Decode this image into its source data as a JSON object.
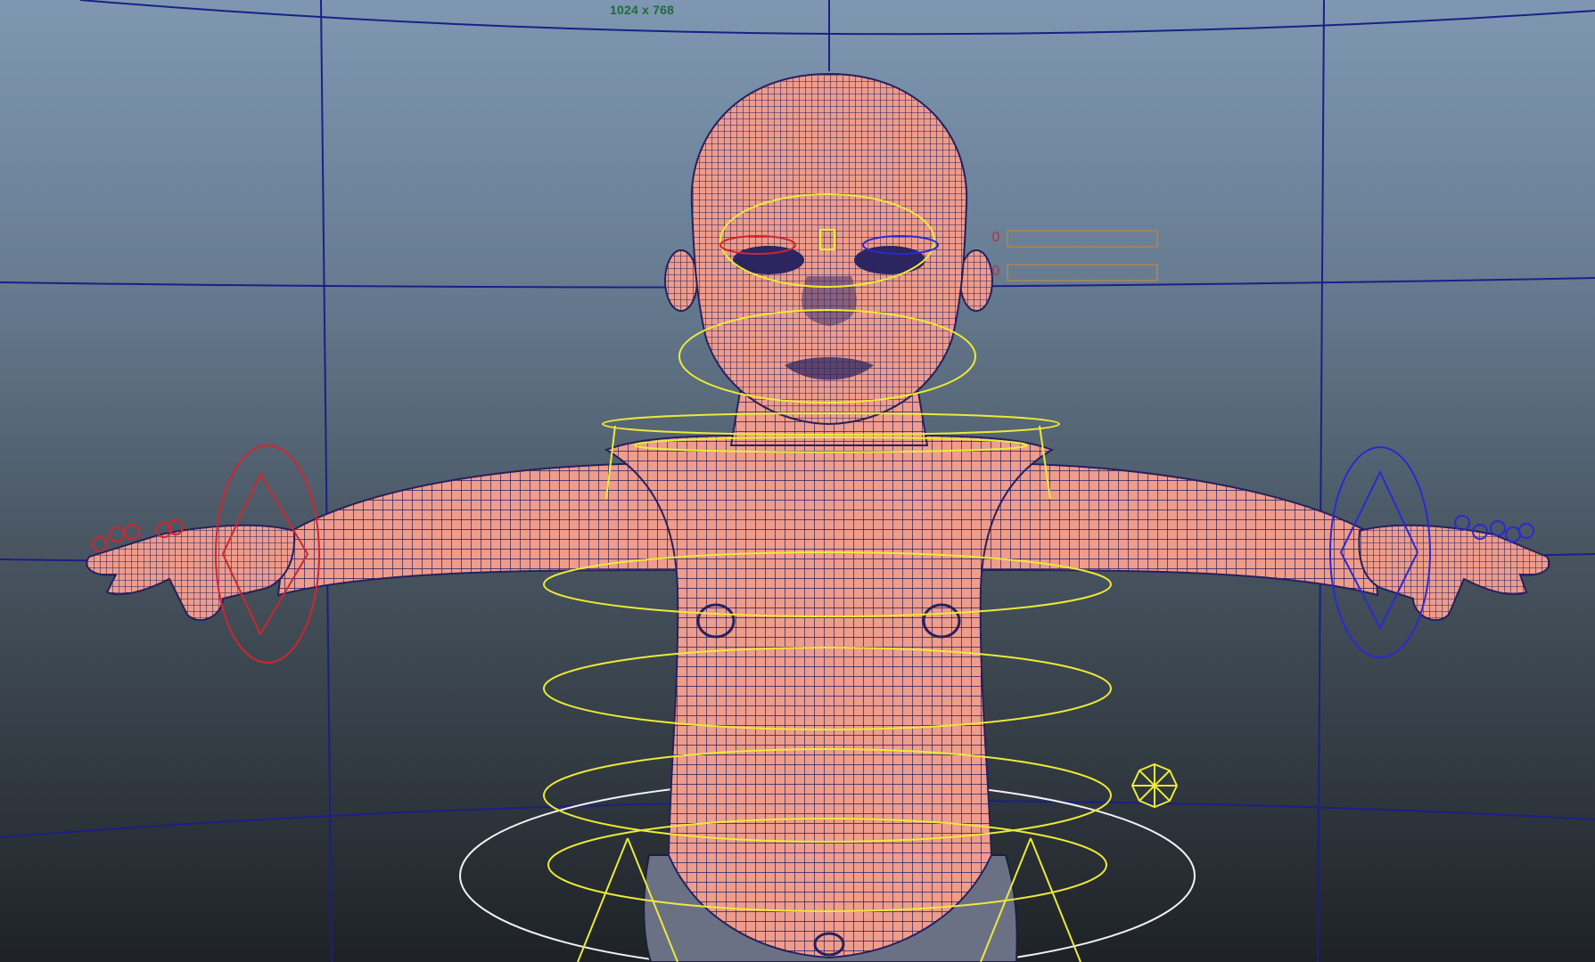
{
  "viewport": {
    "resolution_gate_label": "1024 x 768",
    "colors": {
      "background_top": "#7f97b2",
      "background_bottom": "#1e2226",
      "grid_line": "#1b1f86",
      "skin": "#ee9c8c",
      "wireframe": "#26205e",
      "control_yellow": "#ecea38",
      "control_left_red": "#cf2630",
      "control_right_blue": "#2a2ad2",
      "control_root_white": "#f2f2f2"
    }
  },
  "blend_sliders": [
    {
      "value": "0"
    },
    {
      "value": "0"
    }
  ]
}
